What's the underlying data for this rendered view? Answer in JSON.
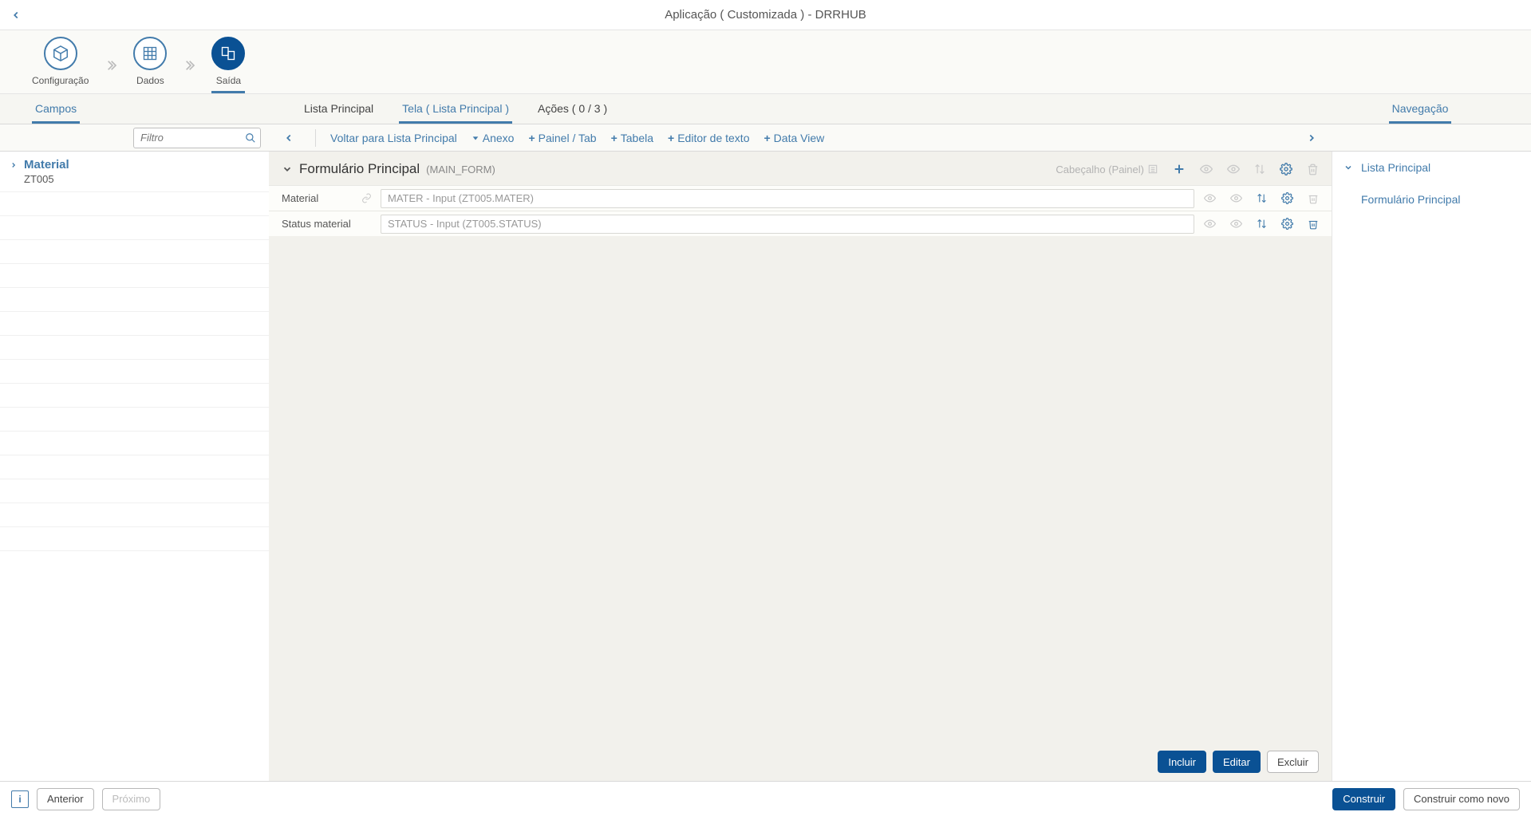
{
  "header": {
    "title": "Aplicação ( Customizada ) - DRRHUB"
  },
  "steps": {
    "items": [
      {
        "label": "Configuração"
      },
      {
        "label": "Dados"
      },
      {
        "label": "Saída"
      }
    ]
  },
  "tabs": {
    "left": {
      "campos": "Campos"
    },
    "center": {
      "lista": "Lista Principal",
      "tela": "Tela ( Lista Principal )",
      "acoes": "Ações ( 0 / 3 )"
    },
    "right": {
      "nav": "Navegação"
    }
  },
  "toolbar": {
    "filter_placeholder": "Filtro",
    "voltar": "Voltar para Lista Principal",
    "anexo": "Anexo",
    "painel": "Painel / Tab",
    "tabela": "Tabela",
    "editor": "Editor de texto",
    "dataview": "Data View"
  },
  "sidebar_left": {
    "material_title": "Material",
    "material_code": "ZT005"
  },
  "form": {
    "title": "Formulário Principal",
    "code": "(MAIN_FORM)",
    "header_label": "Cabeçalho (Painel)",
    "fields": [
      {
        "label": "Material",
        "value": "MATER - Input (ZT005.MATER)"
      },
      {
        "label": "Status material",
        "value": "STATUS - Input (ZT005.STATUS)"
      }
    ],
    "buttons": {
      "incluir": "Incluir",
      "editar": "Editar",
      "excluir": "Excluir"
    }
  },
  "sidebar_right": {
    "lista": "Lista Principal",
    "formulario": "Formulário Principal"
  },
  "footer": {
    "anterior": "Anterior",
    "proximo": "Próximo",
    "construir": "Construir",
    "construir_novo": "Construir como novo"
  }
}
